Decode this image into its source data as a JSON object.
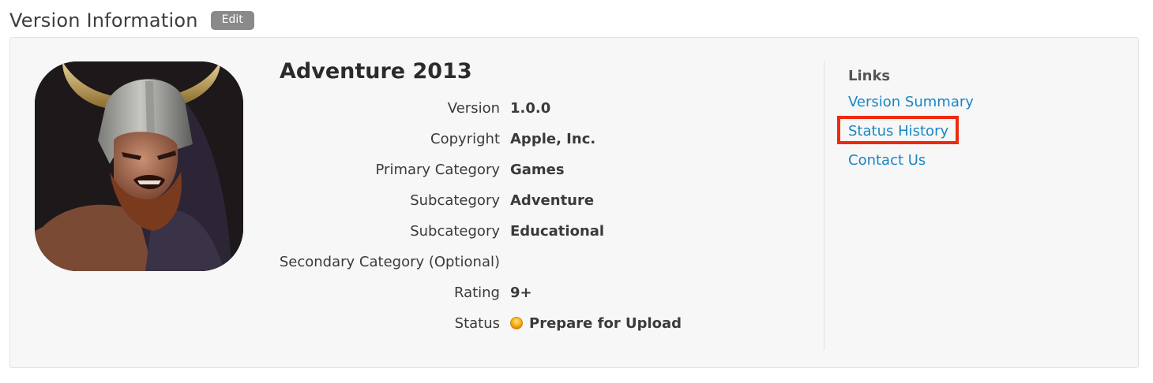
{
  "header": {
    "title": "Version Information",
    "edit_label": "Edit"
  },
  "app": {
    "name": "Adventure 2013",
    "icon": "viking-warrior-icon"
  },
  "details": [
    {
      "label": "Version",
      "value": "1.0.0"
    },
    {
      "label": "Copyright",
      "value": "Apple, Inc."
    },
    {
      "label": "Primary Category",
      "value": "Games"
    },
    {
      "label": "Subcategory",
      "value": "Adventure"
    },
    {
      "label": "Subcategory",
      "value": "Educational"
    },
    {
      "label": "Secondary Category (Optional)",
      "value": ""
    },
    {
      "label": "Rating",
      "value": "9+"
    },
    {
      "label": "Status",
      "value": "Prepare for Upload",
      "status_color": "#f5a623"
    }
  ],
  "links": {
    "title": "Links",
    "items": [
      {
        "label": "Version Summary"
      },
      {
        "label": "Status History",
        "highlighted": true,
        "highlight_color": "#f02a0c"
      },
      {
        "label": "Contact Us"
      }
    ]
  },
  "colors": {
    "link": "#1a85c4",
    "panel_bg": "#f7f7f7",
    "edit_button_bg": "#8a8a8a"
  }
}
